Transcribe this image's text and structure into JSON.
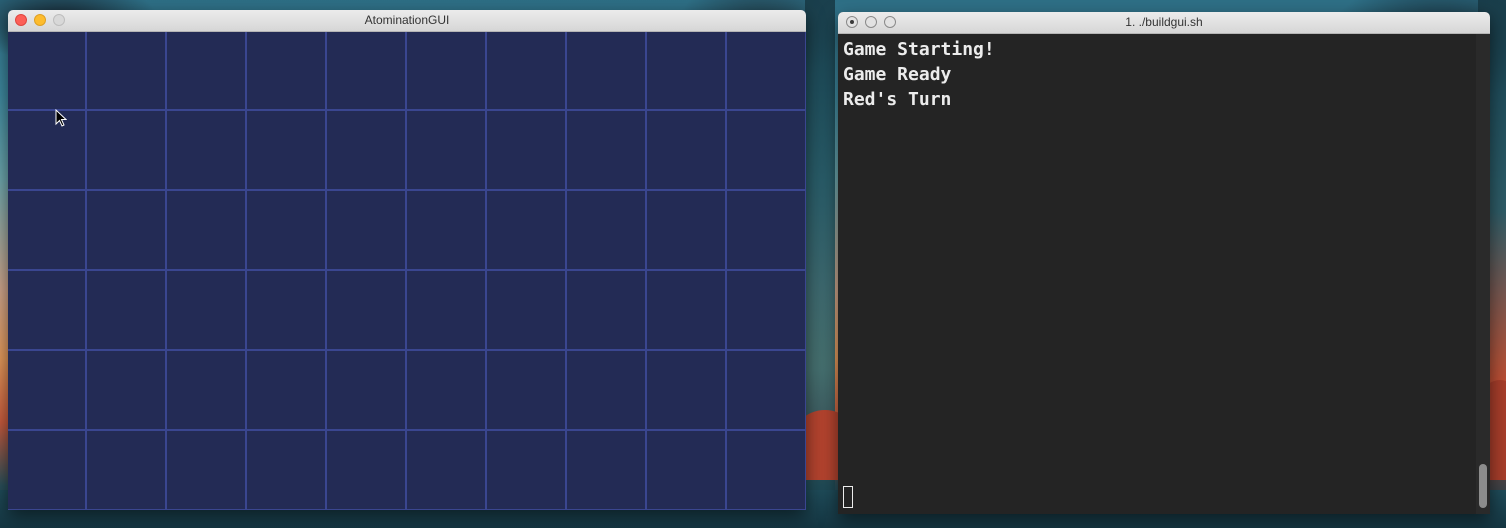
{
  "gui_window": {
    "title": "AtominationGUI",
    "board": {
      "background_color": "#232b55",
      "grid_line_color": "#3a4690"
    }
  },
  "terminal_window": {
    "title": "1. ./buildgui.sh",
    "lines": [
      "Game Starting!",
      "Game Ready",
      "Red's Turn"
    ]
  },
  "icons": {
    "pointer": "arrow-cursor-icon",
    "close": "close-icon",
    "minimize": "minimize-icon",
    "zoom": "zoom-icon"
  }
}
